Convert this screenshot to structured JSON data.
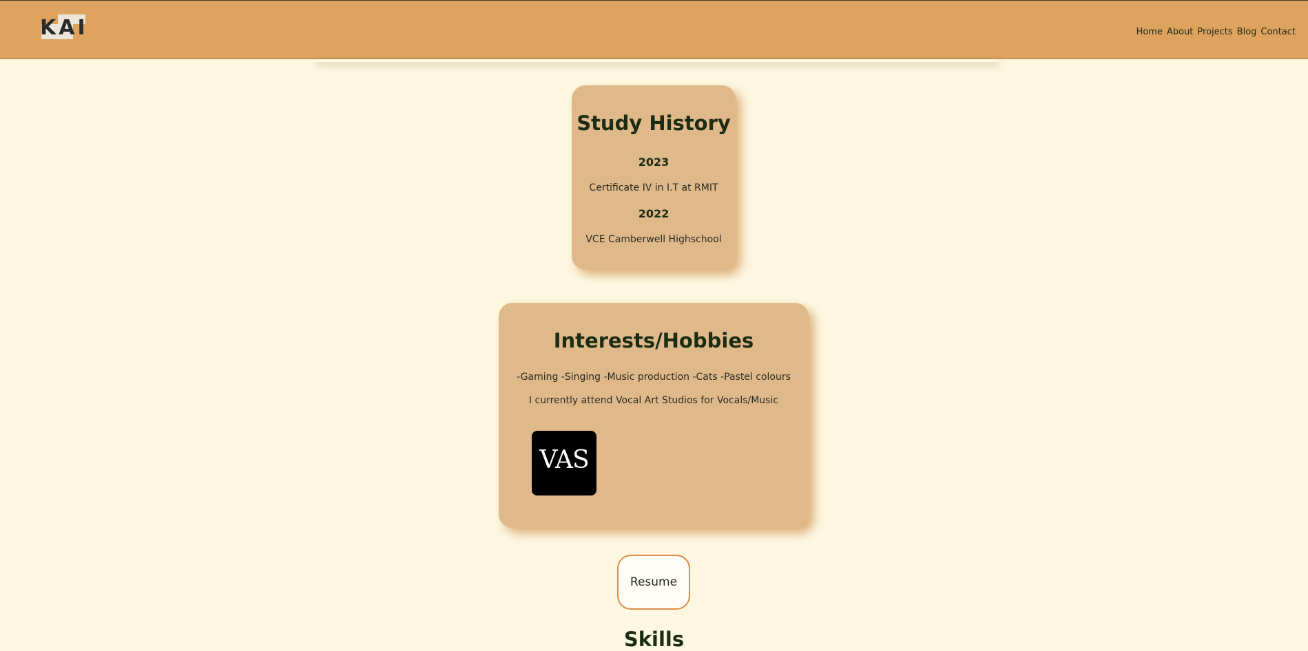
{
  "header": {
    "logo_text": "KAI",
    "nav": [
      "Home",
      "About",
      "Projects",
      "Blog",
      "Contact"
    ]
  },
  "study": {
    "title": "Study History",
    "entries": [
      {
        "year": "2023",
        "desc": "Certificate IV in I.T at RMIT"
      },
      {
        "year": "2022",
        "desc": "VCE Camberwell Highschool"
      }
    ]
  },
  "hobbies": {
    "title": "Interests/Hobbies",
    "list_text": "-Gaming -Singing -Music production -Cats -Pastel colours",
    "note": "I currently attend Vocal Art Studios for Vocals/Music",
    "logo_text": "VAS"
  },
  "resume_label": "Resume",
  "skills_title": "Skills",
  "colors": {
    "header_bg": "#dda35f",
    "page_bg": "#fdf7e1",
    "card_bg": "#dfb98a",
    "accent_border": "#d98d45"
  }
}
